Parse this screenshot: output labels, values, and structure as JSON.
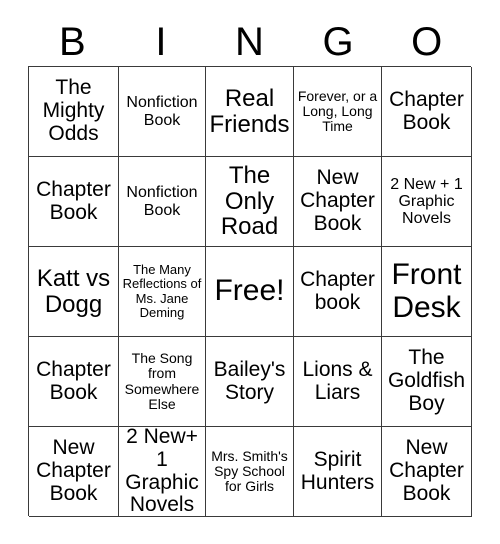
{
  "header": {
    "letters": [
      "B",
      "I",
      "N",
      "G",
      "O"
    ]
  },
  "grid": {
    "rows": 5,
    "columns": 5,
    "border_color": "#3a3a3a",
    "background_color": "#ffffff",
    "text_color": "#000000",
    "cells": [
      [
        {
          "text": "The Mighty Odds",
          "size": "md"
        },
        {
          "text": "Nonfiction Book",
          "size": "sm"
        },
        {
          "text": "Real Friends",
          "size": "lg"
        },
        {
          "text": "Forever, or a Long, Long Time",
          "size": "xs"
        },
        {
          "text": "Chapter Book",
          "size": "md"
        }
      ],
      [
        {
          "text": "Chapter Book",
          "size": "md"
        },
        {
          "text": "Nonfiction Book",
          "size": "sm"
        },
        {
          "text": "The Only Road",
          "size": "lg"
        },
        {
          "text": "New Chapter Book",
          "size": "md"
        },
        {
          "text": "2 New + 1 Graphic Novels",
          "size": "sm"
        }
      ],
      [
        {
          "text": "Katt vs Dogg",
          "size": "lg"
        },
        {
          "text": "The Many Reflections of Ms. Jane Deming",
          "size": "xxs"
        },
        {
          "text": "Free!",
          "size": "xl"
        },
        {
          "text": "Chapter book",
          "size": "md"
        },
        {
          "text": "Front Desk",
          "size": "xl"
        }
      ],
      [
        {
          "text": "Chapter Book",
          "size": "md"
        },
        {
          "text": "The Song from Somewhere Else",
          "size": "xs"
        },
        {
          "text": "Bailey's Story",
          "size": "md"
        },
        {
          "text": "Lions & Liars",
          "size": "md"
        },
        {
          "text": "The Goldfish Boy",
          "size": "md"
        }
      ],
      [
        {
          "text": "New Chapter Book",
          "size": "md"
        },
        {
          "text": "2 New+ 1 Graphic Novels",
          "size": "md"
        },
        {
          "text": "Mrs. Smith's Spy School for Girls",
          "size": "xs"
        },
        {
          "text": "Spirit Hunters",
          "size": "md"
        },
        {
          "text": "New Chapter Book",
          "size": "md"
        }
      ]
    ]
  }
}
